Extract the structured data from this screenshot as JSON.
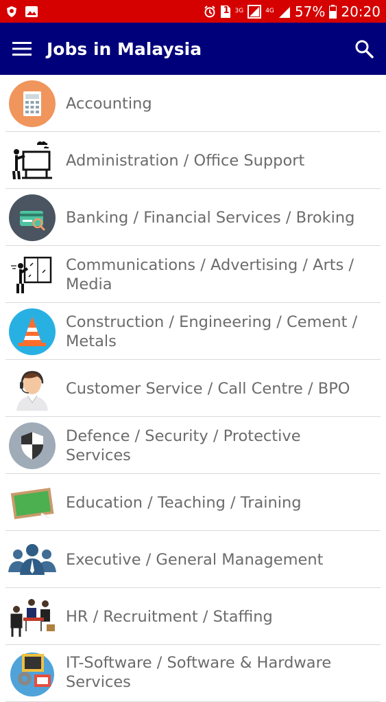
{
  "status_bar": {
    "battery": "57%",
    "time": "20:20",
    "network_3g": "3G",
    "network_4g": "4G",
    "sim": "1"
  },
  "app_bar": {
    "title": "Jobs in Malaysia",
    "background": "#00007a"
  },
  "categories": [
    {
      "label": "Accounting",
      "icon": "calculator-icon"
    },
    {
      "label": "Administration / Office Support",
      "icon": "presentation-board-icon"
    },
    {
      "label": "Banking / Financial Services / Broking",
      "icon": "credit-card-icon"
    },
    {
      "label": "Communications / Advertising / Arts / Media",
      "icon": "presenter-icon"
    },
    {
      "label": "Construction / Engineering / Cement / Metals",
      "icon": "traffic-cone-icon"
    },
    {
      "label": "Customer Service / Call Centre / BPO",
      "icon": "headset-agent-icon"
    },
    {
      "label": "Defence / Security / Protective Services",
      "icon": "shield-icon"
    },
    {
      "label": "Education / Teaching / Training",
      "icon": "chalkboard-icon"
    },
    {
      "label": "Executive / General Management",
      "icon": "people-group-icon"
    },
    {
      "label": "HR / Recruitment / Staffing",
      "icon": "interview-icon"
    },
    {
      "label": "IT-Software / Software & Hardware Services",
      "icon": "computer-icon"
    }
  ]
}
